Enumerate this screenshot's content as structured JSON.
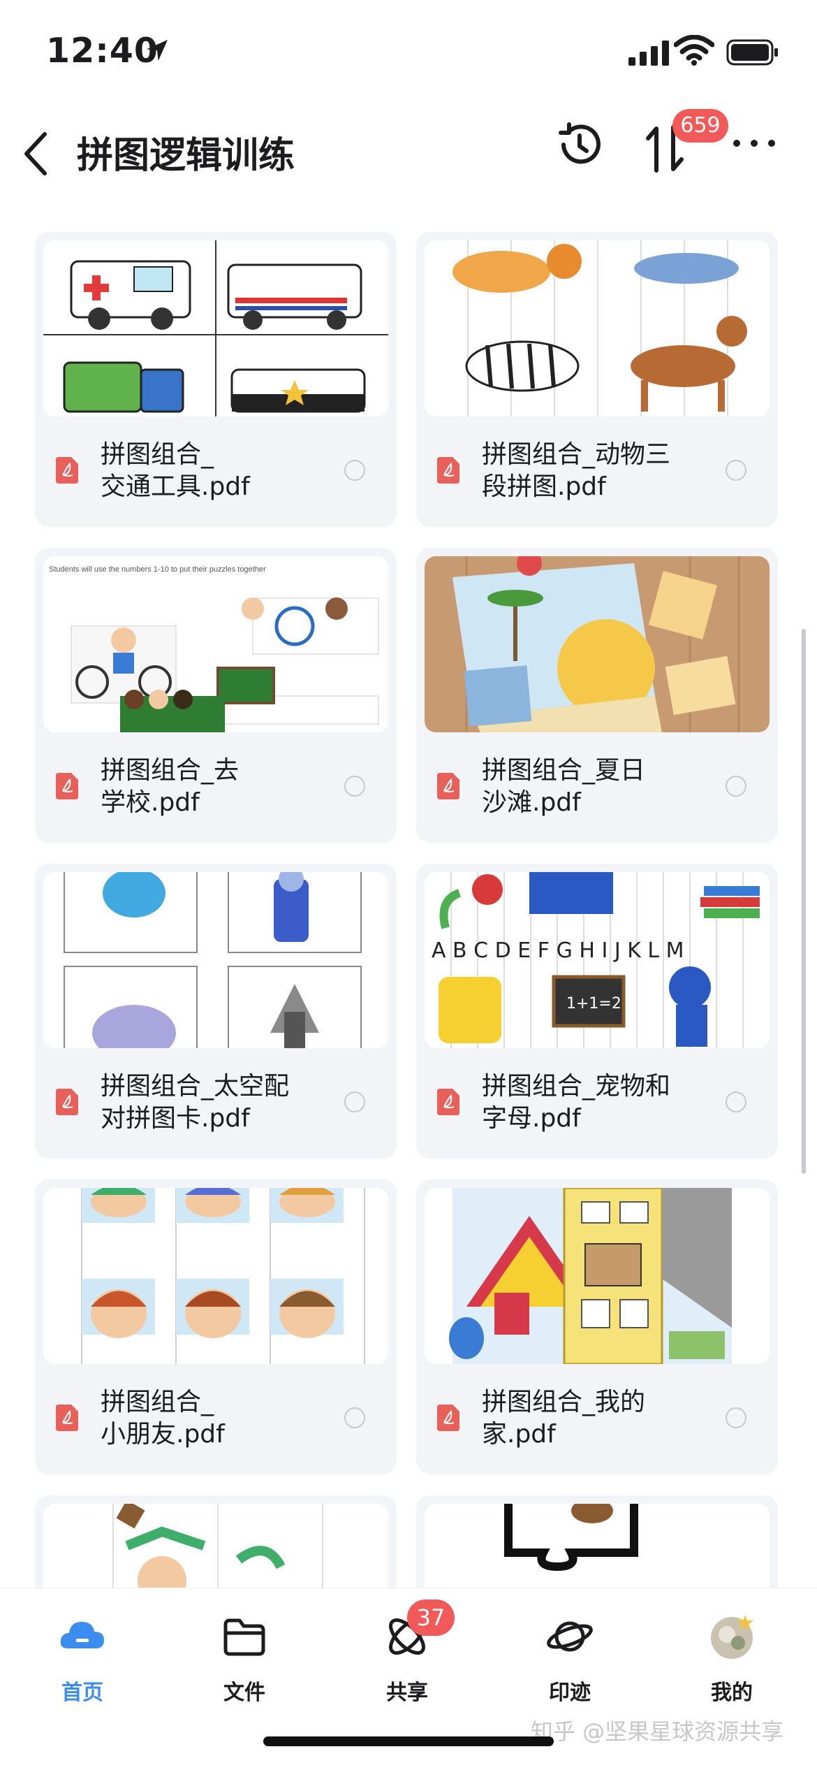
{
  "status_bar": {
    "time": "12:40"
  },
  "header": {
    "title": "拼图逻辑训练",
    "sort_badge": "659"
  },
  "files": [
    {
      "name": "拼图组合_交通工具.pdf",
      "line1": "拼图组合_",
      "line2": "交通工具.pdf"
    },
    {
      "name": "拼图组合_动物三段拼图.pdf",
      "line1": "拼图组合_动物三",
      "line2": "段拼图.pdf"
    },
    {
      "name": "拼图组合_去学校.pdf",
      "line1": "拼图组合_去",
      "line2": "学校.pdf"
    },
    {
      "name": "拼图组合_夏日沙滩.pdf",
      "line1": "拼图组合_夏日",
      "line2": "沙滩.pdf"
    },
    {
      "name": "拼图组合_太空配对拼图卡.pdf",
      "line1": "拼图组合_太空配",
      "line2": "对拼图卡.pdf"
    },
    {
      "name": "拼图组合_宠物和字母.pdf",
      "line1": "拼图组合_宠物和",
      "line2": "字母.pdf"
    },
    {
      "name": "拼图组合_小朋友.pdf",
      "line1": "拼图组合_",
      "line2": "小朋友.pdf"
    },
    {
      "name": "拼图组合_我的家.pdf",
      "line1": "拼图组合_我的",
      "line2": "家.pdf"
    }
  ],
  "thumb_text": {
    "school_caption": "Students will use the numbers 1-10 to put their puzzles together",
    "alphabet": "A B C D E F G H I J K L M",
    "math": "1+1=2"
  },
  "tabbar": {
    "tabs": [
      {
        "label": "首页",
        "icon": "cloud-home-icon",
        "active": true
      },
      {
        "label": "文件",
        "icon": "folder-icon"
      },
      {
        "label": "共享",
        "icon": "orbit-share-icon",
        "badge": "37"
      },
      {
        "label": "印迹",
        "icon": "planet-icon"
      },
      {
        "label": "我的",
        "icon": "avatar-icon"
      }
    ],
    "watermark": "知乎 @坚果星球资源共享"
  },
  "colors": {
    "accent": "#3b8df0",
    "badge": "#f25a5a",
    "card": "#f3f4f7",
    "pdf": "#e8605a"
  }
}
